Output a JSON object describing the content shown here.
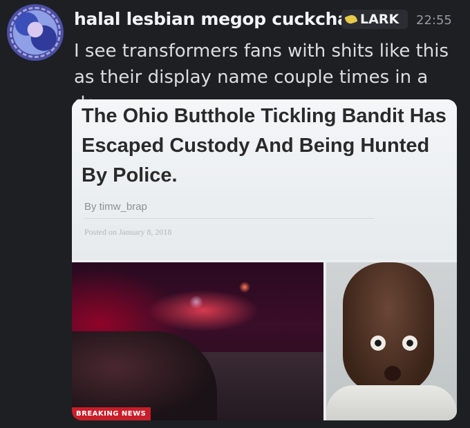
{
  "post": {
    "author": "halal lesbian megop cuckchair",
    "tag": "LARK",
    "time": "22:55",
    "message": "I see transformers fans with shits like this as their display name couple times in a day"
  },
  "embed": {
    "headline": "The Ohio Butthole Tickling Bandit Has Escaped Custody And Being Hunted By Police.",
    "byline": "By timw_brap",
    "posted": "Posted on January 8, 2018",
    "ticker": "BREAKING NEWS"
  }
}
